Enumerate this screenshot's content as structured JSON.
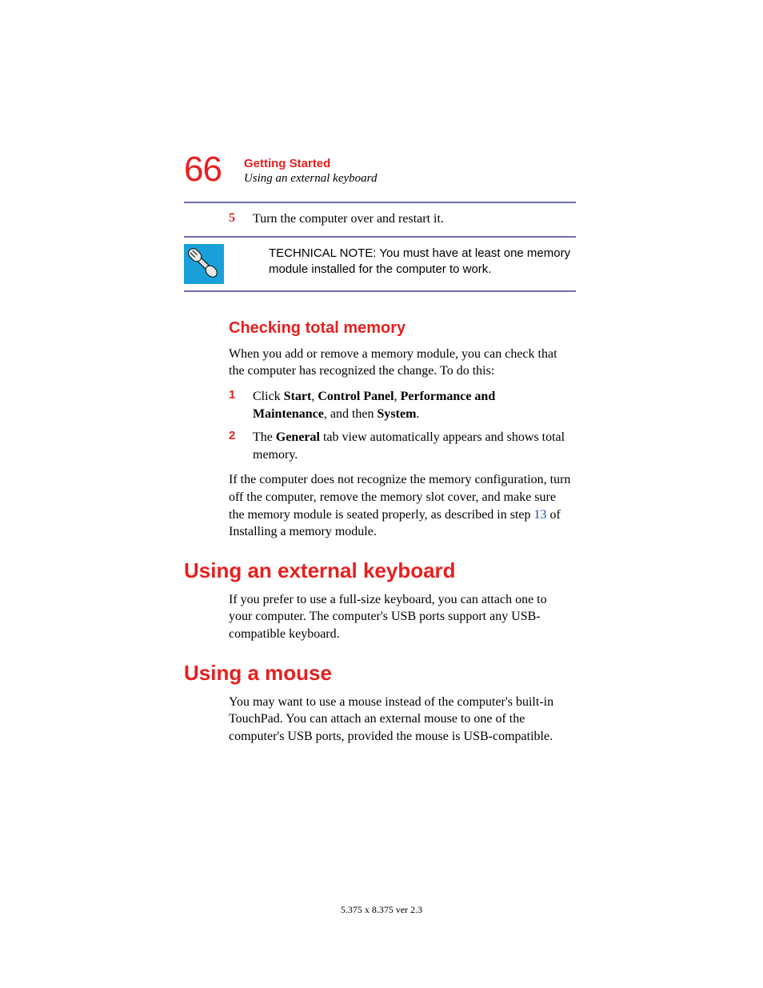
{
  "header": {
    "page_number": "66",
    "chapter": "Getting Started",
    "subtitle": "Using an external keyboard"
  },
  "step5": {
    "num": "5",
    "text": "Turn the computer over and restart it."
  },
  "tech_note": "TECHNICAL NOTE: You must have at least one memory module installed for the computer to work.",
  "checking": {
    "heading": "Checking total memory",
    "intro": "When you add or remove a memory module, you can check that the computer has recognized the change. To do this:",
    "item1": {
      "num": "1",
      "pre": "Click ",
      "b1": "Start",
      "s1": ", ",
      "b2": "Control Panel",
      "s2": ", ",
      "b3": "Performance and Maintenance",
      "s3": ", and then ",
      "b4": "System",
      "s4": "."
    },
    "item2": {
      "num": "2",
      "pre": "The ",
      "b1": "General",
      "post": " tab view automatically appears and shows total memory."
    },
    "tail_pre": "If the computer does not recognize the memory configuration, turn off the computer, remove the memory slot cover, and make sure the memory module is seated properly, as described in step ",
    "tail_link": "13",
    "tail_post": " of Installing a memory module."
  },
  "ext_kb": {
    "heading": "Using an external keyboard",
    "body": "If you prefer to use a full-size keyboard, you can attach one to your computer. The computer's USB ports support any USB-compatible keyboard."
  },
  "mouse": {
    "heading": "Using a mouse",
    "body": "You may want to use a mouse instead of the computer's built-in TouchPad. You can attach an external mouse to one of the computer's USB ports, provided the mouse is USB-compatible."
  },
  "footer": "5.375 x 8.375 ver 2.3"
}
